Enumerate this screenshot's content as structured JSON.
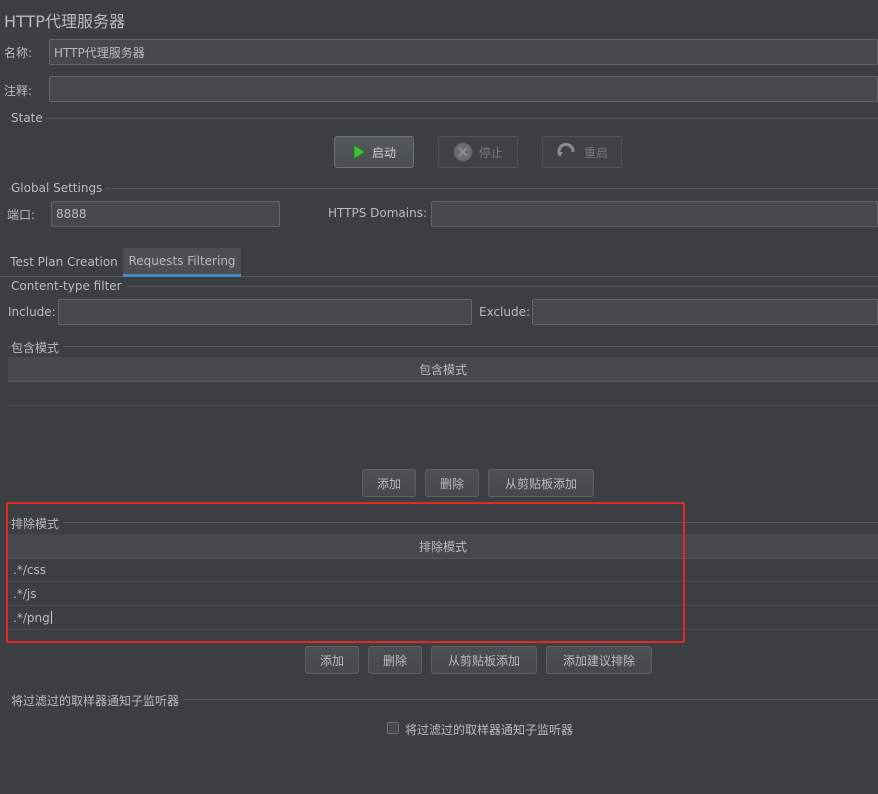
{
  "window": {
    "title": "HTTP代理服务器"
  },
  "name_field": {
    "label": "名称:",
    "value": "HTTP代理服务器"
  },
  "comment_field": {
    "label": "注释:",
    "value": ""
  },
  "state": {
    "section_title": "State",
    "start_label": "启动",
    "stop_label": "停止",
    "restart_label": "重启"
  },
  "global_settings": {
    "section_title": "Global Settings",
    "port_label": "端口:",
    "port_value": "8888",
    "https_label": "HTTPS Domains:",
    "https_value": ""
  },
  "tabs": [
    {
      "label": "Test Plan Creation",
      "active": false
    },
    {
      "label": "Requests Filtering",
      "active": true
    }
  ],
  "content_type_filter": {
    "section_title": "Content-type filter",
    "include_label": "Include:",
    "include_value": "",
    "exclude_label": "Exclude:",
    "exclude_value": ""
  },
  "include_patterns": {
    "section_title": "包含模式",
    "column_header": "包含模式",
    "rows": [],
    "buttons": {
      "add": "添加",
      "delete": "删除",
      "add_from_clipboard": "从剪贴板添加"
    }
  },
  "exclude_patterns": {
    "section_title": "排除模式",
    "column_header": "排除模式",
    "rows": [
      ".*/css",
      ".*/js",
      ".*/png"
    ],
    "buttons": {
      "add": "添加",
      "delete": "删除",
      "add_from_clipboard": "从剪贴板添加",
      "add_suggested": "添加建议排除"
    }
  },
  "notify": {
    "section_title": "将过滤过的取样器通知子监听器",
    "checkbox_label": "将过滤过的取样器通知子监听器",
    "checked": false
  },
  "colors": {
    "background": "#3c3f41",
    "highlight": "#e22828",
    "tab_accent": "#4a88c7",
    "play_green": "#3fbf3f"
  }
}
